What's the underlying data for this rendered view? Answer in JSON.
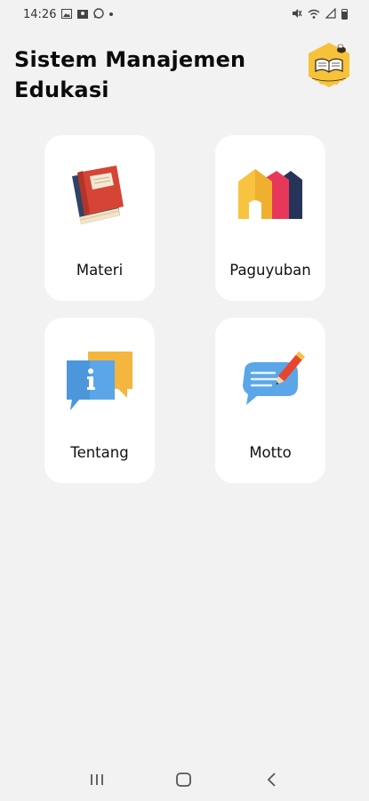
{
  "status_bar": {
    "time": "14:26",
    "left_icons": [
      "image-icon",
      "photo-icon",
      "whatsapp-icon",
      "dot-icon"
    ],
    "right_icons": [
      "mute-icon",
      "wifi-icon",
      "signal-icon",
      "battery-icon"
    ]
  },
  "header": {
    "title": "Sistem Manajemen Edukasi",
    "logo_icon": "school-logo-icon"
  },
  "menu": [
    {
      "id": "materi",
      "label": "Materi",
      "icon": "book-icon"
    },
    {
      "id": "paguyuban",
      "label": "Paguyuban",
      "icon": "houses-icon"
    },
    {
      "id": "tentang",
      "label": "Tentang",
      "icon": "info-chat-icon"
    },
    {
      "id": "motto",
      "label": "Motto",
      "icon": "note-pencil-icon"
    }
  ],
  "nav_bar": {
    "buttons": [
      "recent-apps-icon",
      "home-icon",
      "back-icon"
    ]
  },
  "colors": {
    "background": "#f2f2f2",
    "card": "#ffffff",
    "title": "#0b0b0b",
    "book_red": "#d64435",
    "book_blue": "#2e4466",
    "house_yellow": "#f7c340",
    "house_pink": "#e8385a",
    "house_navy": "#27345a",
    "chat_blue": "#5aa6e8",
    "chat_yellow": "#f4b63f"
  }
}
